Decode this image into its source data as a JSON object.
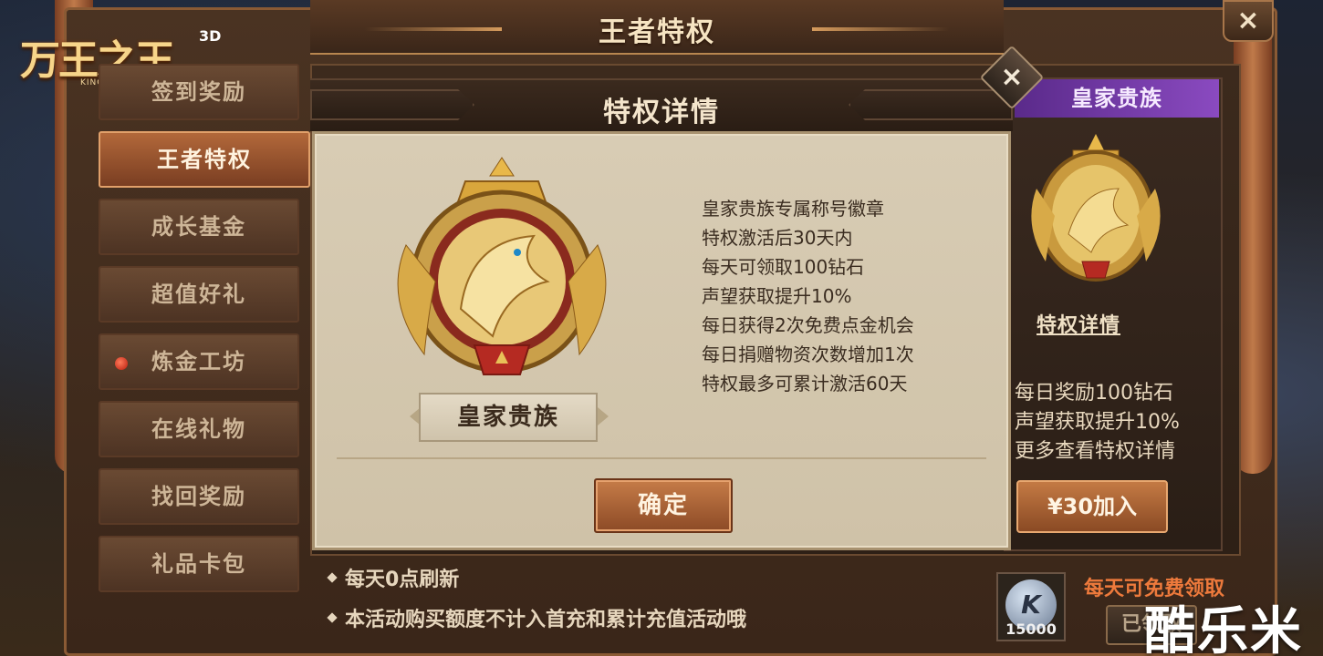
{
  "header": {
    "title": "王者特权"
  },
  "logo": {
    "main": "万王之王",
    "tag": "3D",
    "sub": "KING OF KINGS"
  },
  "sidebar": {
    "items": [
      {
        "label": "签到奖励",
        "active": false,
        "dot": false
      },
      {
        "label": "王者特权",
        "active": true,
        "dot": false
      },
      {
        "label": "成长基金",
        "active": false,
        "dot": false
      },
      {
        "label": "超值好礼",
        "active": false,
        "dot": false
      },
      {
        "label": "炼金工坊",
        "active": false,
        "dot": true
      },
      {
        "label": "在线礼物",
        "active": false,
        "dot": false
      },
      {
        "label": "找回奖励",
        "active": false,
        "dot": false
      },
      {
        "label": "礼品卡包",
        "active": false,
        "dot": false
      }
    ]
  },
  "card": {
    "banner": "皇家贵族",
    "detail_link": "特权详情",
    "lines": [
      "每日奖励100钻石",
      "声望获取提升10%",
      "更多查看特权详情"
    ],
    "buy_label": "¥30加入"
  },
  "notes": [
    "每天0点刷新",
    "本活动购买额度不计入首充和累计充值活动哦"
  ],
  "free_reward": {
    "coin_letter": "K",
    "amount": "15000",
    "text": "每天可免费领取",
    "claimed_label": "已领取"
  },
  "modal": {
    "title": "特权详情",
    "badge_name": "皇家贵族",
    "perks": [
      "皇家贵族专属称号徽章",
      "特权激活后30天内",
      "每天可领取100钻石",
      "声望获取提升10%",
      "每日获得2次免费点金机会",
      "每日捐赠物资次数增加1次",
      "特权最多可累计激活60天"
    ],
    "confirm_label": "确定",
    "close_icon": "×"
  },
  "main_close_icon": "×",
  "watermark": "酷乐米",
  "colors": {
    "accent": "#c67c48",
    "card_banner": "#8a4ac0",
    "free_text": "#ee7a3c"
  }
}
